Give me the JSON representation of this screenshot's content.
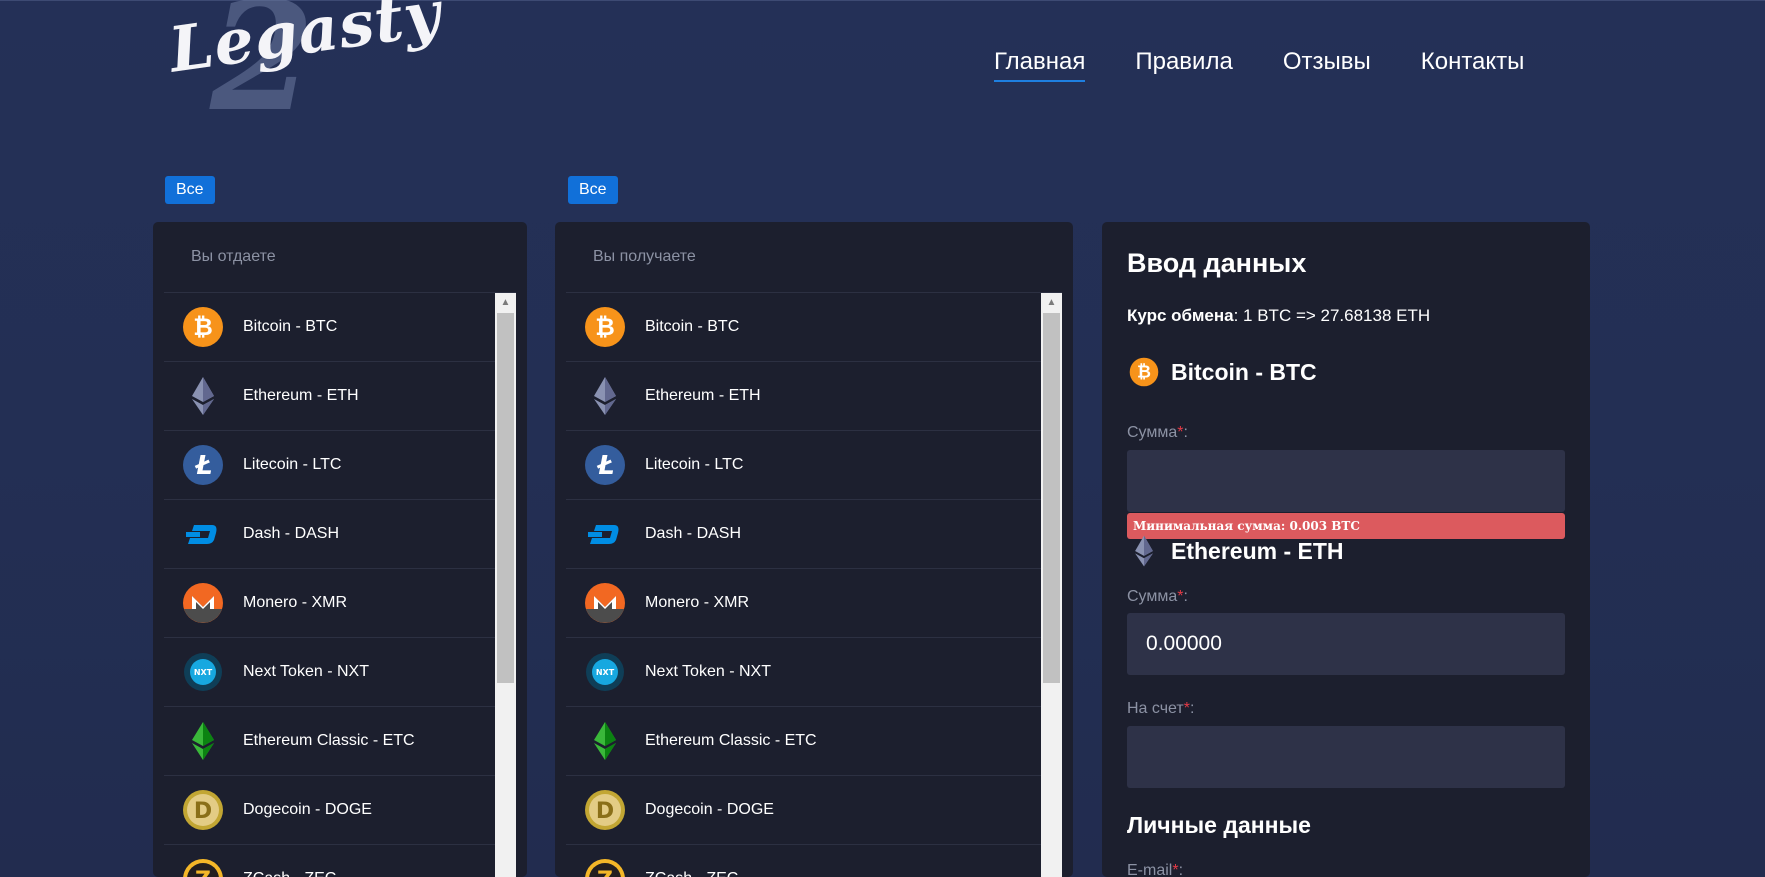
{
  "brand": {
    "logo_text": "Legasty",
    "logo_numeral": "2"
  },
  "nav": {
    "items": [
      {
        "label": "Главная",
        "active": true
      },
      {
        "label": "Правила",
        "active": false
      },
      {
        "label": "Отзывы",
        "active": false
      },
      {
        "label": "Контакты",
        "active": false
      }
    ]
  },
  "filters": {
    "give_all": "Все",
    "get_all": "Все"
  },
  "give_panel": {
    "title": "Вы отдаете"
  },
  "get_panel": {
    "title": "Вы получаете"
  },
  "coins": [
    {
      "label": "Bitcoin - BTC",
      "icon": "bitcoin-icon"
    },
    {
      "label": "Ethereum - ETH",
      "icon": "ethereum-icon"
    },
    {
      "label": "Litecoin - LTC",
      "icon": "litecoin-icon"
    },
    {
      "label": "Dash - DASH",
      "icon": "dash-icon"
    },
    {
      "label": "Monero - XMR",
      "icon": "monero-icon"
    },
    {
      "label": "Next Token - NXT",
      "icon": "nxt-icon"
    },
    {
      "label": "Ethereum Classic - ETC",
      "icon": "ethereum-classic-icon"
    },
    {
      "label": "Dogecoin - DOGE",
      "icon": "dogecoin-icon"
    },
    {
      "label": "ZCash - ZEC",
      "icon": "zcash-icon"
    }
  ],
  "form": {
    "title": "Ввод данных",
    "rate_label": "Курс обмена",
    "rate_value": ": 1 BTC => 27.68138 ETH",
    "give_currency": "Bitcoin - BTC",
    "give_amount_label": "Сумма",
    "give_amount_value": "",
    "min_amount_error": "Минимальная сумма: 0.003 BTC",
    "get_currency": "Ethereum - ETH",
    "get_amount_label": "Сумма",
    "get_amount_value": "0.00000",
    "account_label": "На счет",
    "account_value": "",
    "required_mark": "*",
    "colon": ":",
    "personal_title": "Личные данные",
    "email_label": "E-mail"
  },
  "colors": {
    "accent": "#1170d9",
    "error": "#dc5a5e",
    "bitcoin": "#f7931a",
    "litecoin": "#345d9d",
    "dash": "#008de4",
    "monero": "#f26822",
    "etc": "#3ab83a",
    "doge": "#c2a633"
  }
}
